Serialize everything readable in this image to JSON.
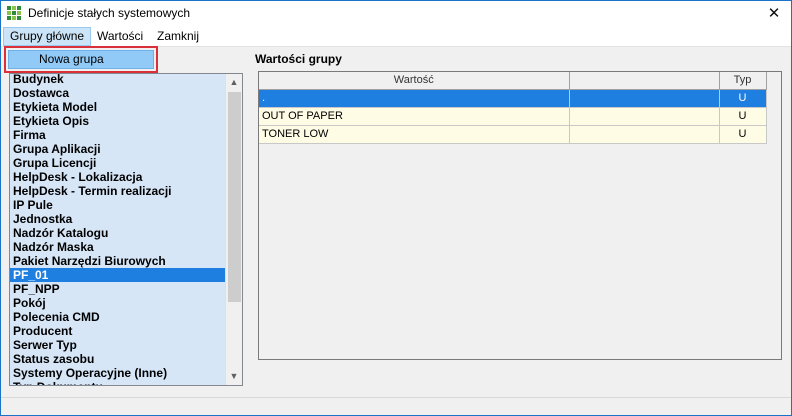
{
  "window": {
    "title": "Definicje stałych systemowych",
    "close_label": "✕"
  },
  "menubar": {
    "items": [
      {
        "label": "Grupy główne"
      },
      {
        "label": "Wartości"
      },
      {
        "label": "Zamknij"
      }
    ]
  },
  "dropdown": {
    "items": [
      {
        "label": "Nowa grupa"
      }
    ]
  },
  "groups": {
    "items": [
      "Budynek",
      "Dostawca",
      "Etykieta Model",
      "Etykieta Opis",
      "Firma",
      "Grupa Aplikacji",
      "Grupa Licencji",
      "HelpDesk - Lokalizacja",
      "HelpDesk - Termin realizacji",
      "IP Pule",
      "Jednostka",
      "Nadzór Katalogu",
      "Nadzór Maska",
      "Pakiet Narzędzi Biurowych",
      "PF_01",
      "PF_NPP",
      "Pokój",
      "Polecenia CMD",
      "Producent",
      "Serwer Typ",
      "Status zasobu",
      "Systemy Operacyjne (Inne)",
      "Typ Dokumentu"
    ],
    "selected": "PF_01"
  },
  "values_panel": {
    "title": "Wartości grupy",
    "columns": [
      "Wartość",
      "",
      "Typ"
    ],
    "rows": [
      {
        "value": ".",
        "extra": "",
        "typ": "U",
        "selected": true
      },
      {
        "value": "OUT OF PAPER",
        "extra": "",
        "typ": "U",
        "selected": false
      },
      {
        "value": "TONER LOW",
        "extra": "",
        "typ": "U",
        "selected": false
      }
    ]
  },
  "icons": {
    "app": "grid-app-icon",
    "close": "close-icon",
    "scroll_up": "scroll-up-icon",
    "scroll_down": "scroll-down-icon"
  },
  "colors": {
    "selection": "#1e7fe0",
    "list_background": "#d6e6f7",
    "grid_row_background": "#fffce6",
    "menu_highlight": "#91c9f7",
    "callout_border": "#d9303a"
  }
}
